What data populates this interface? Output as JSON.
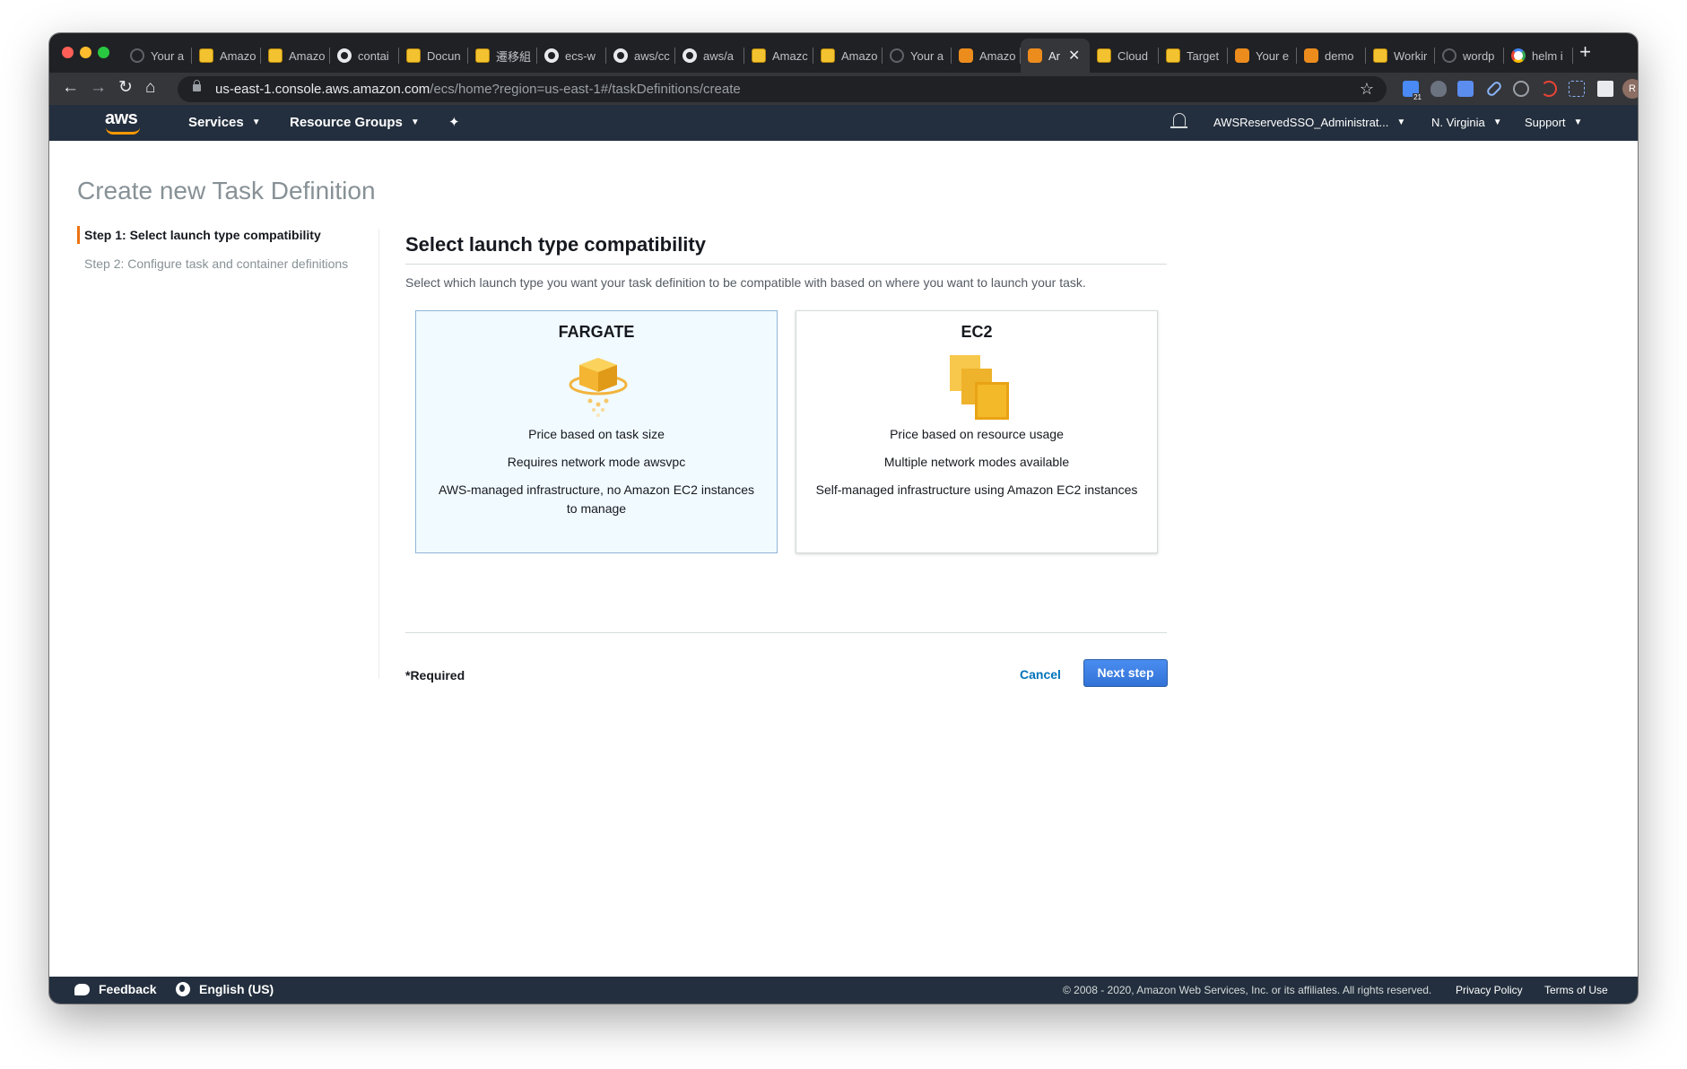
{
  "browser": {
    "tabs": [
      {
        "label": "Your a",
        "icon": "globe-icon"
      },
      {
        "label": "Amazo",
        "icon": "aws-box-icon"
      },
      {
        "label": "Amazo",
        "icon": "aws-box-icon"
      },
      {
        "label": "contai",
        "icon": "github-icon"
      },
      {
        "label": "Docun",
        "icon": "aws-box-icon"
      },
      {
        "label": "遷移組",
        "icon": "aws-box-icon"
      },
      {
        "label": "ecs-w",
        "icon": "github-icon"
      },
      {
        "label": "aws/cc",
        "icon": "github-icon"
      },
      {
        "label": "aws/a",
        "icon": "github-icon"
      },
      {
        "label": "Amazc",
        "icon": "aws-box-icon"
      },
      {
        "label": "Amazo",
        "icon": "aws-box-icon"
      },
      {
        "label": "Your a",
        "icon": "globe-icon"
      },
      {
        "label": "Amazo",
        "icon": "ecs-icon"
      },
      {
        "label": "Ar",
        "icon": "ecs-icon",
        "active": true
      },
      {
        "label": "Cloud",
        "icon": "aws-box-icon"
      },
      {
        "label": "Target",
        "icon": "aws-box-icon"
      },
      {
        "label": "Your e",
        "icon": "ecs-icon"
      },
      {
        "label": "demo",
        "icon": "ecs-icon"
      },
      {
        "label": "Workir",
        "icon": "aws-box-icon"
      },
      {
        "label": "wordp",
        "icon": "globe-icon"
      },
      {
        "label": "helm i",
        "icon": "google-icon"
      }
    ],
    "url_host": "us-east-1.console.aws.amazon.com",
    "url_path": "/ecs/home?region=us-east-1#/taskDefinitions/create",
    "extension_badge": "21",
    "profile_initial": "R"
  },
  "awsnav": {
    "logo": "aws",
    "services": "Services",
    "resource_groups": "Resource Groups",
    "account": "AWSReservedSSO_Administrat...",
    "region": "N. Virginia",
    "support": "Support"
  },
  "page": {
    "title": "Create new Task Definition",
    "steps": [
      "Step 1: Select launch type compatibility",
      "Step 2: Configure task and container definitions"
    ],
    "section_title": "Select launch type compatibility",
    "section_desc": "Select which launch type you want your task definition to be compatible with based on where you want to launch your task.",
    "cards": {
      "fargate": {
        "title": "FARGATE",
        "line1": "Price based on task size",
        "line2": "Requires network mode awsvpc",
        "line3": "AWS-managed infrastructure, no Amazon EC2 instances to manage",
        "selected": true
      },
      "ec2": {
        "title": "EC2",
        "line1": "Price based on resource usage",
        "line2": "Multiple network modes available",
        "line3": "Self-managed infrastructure using Amazon EC2 instances",
        "selected": false
      }
    },
    "required": "*Required",
    "cancel": "Cancel",
    "next": "Next step"
  },
  "footer": {
    "feedback": "Feedback",
    "language": "English (US)",
    "copyright": "© 2008 - 2020, Amazon Web Services, Inc. or its affiliates. All rights reserved.",
    "privacy": "Privacy Policy",
    "terms": "Terms of Use"
  },
  "colors": {
    "aws_nav_bg": "#232f3e",
    "accent_orange": "#ec7211",
    "primary_button": "#3272d6",
    "link_blue": "#0073bb"
  }
}
